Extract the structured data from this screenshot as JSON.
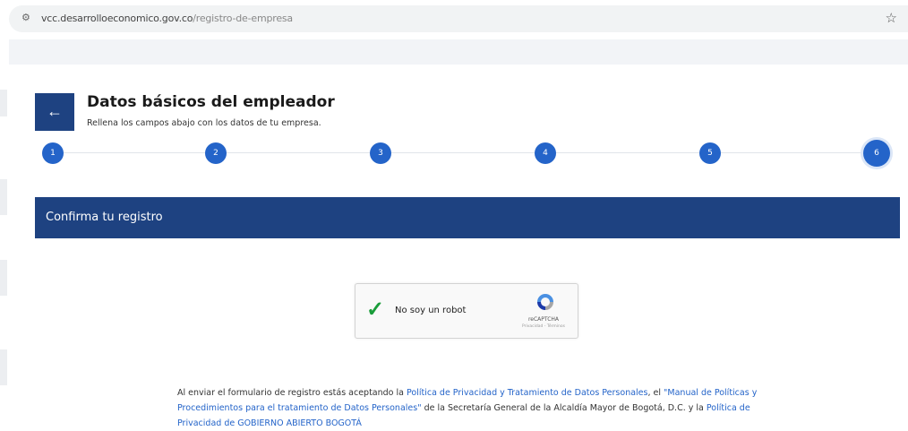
{
  "browser": {
    "url_host": "vcc.desarrolloeconomico.gov.co",
    "url_path": "/registro-de-empresa",
    "site_icon": "tune-icon",
    "bookmark_icon": "star-icon"
  },
  "header": {
    "back_icon": "arrow-left-icon",
    "title": "Datos básicos del empleador",
    "subtitle": "Rellena los campos abajo con los datos de tu empresa."
  },
  "stepper": {
    "steps": [
      "1",
      "2",
      "3",
      "4",
      "5",
      "6"
    ],
    "active_step": "6"
  },
  "confirm_section": {
    "title": "Confirma tu registro"
  },
  "recaptcha": {
    "checkbox_label": "No soy un robot",
    "brand": "reCAPTCHA",
    "links": "Privacidad - Términos"
  },
  "legal": {
    "text_1": "Al enviar el formulario de registro estás aceptando la ",
    "link_1": "Política de Privacidad y Tratamiento de Datos Personales",
    "text_2": ", el ",
    "link_2": "\"Manual de Políticas y Procedimientos para el tratamiento de Datos Personales\"",
    "text_3": " de la Secretaría General de la Alcaldía Mayor de Bogotá, D.C. y la ",
    "link_3": "Política de Privacidad de GOBIERNO ABIERTO BOGOTÁ"
  },
  "colors": {
    "primary": "#1e4281",
    "step": "#2464c9",
    "link": "#2464c9",
    "check": "#1a9d3a"
  }
}
